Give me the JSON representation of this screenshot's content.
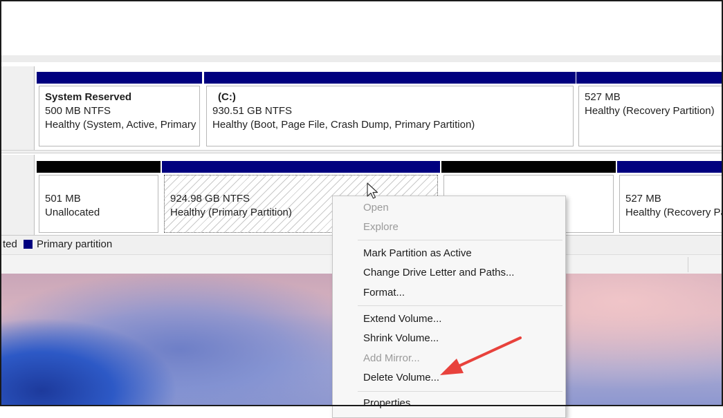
{
  "disks": {
    "disk0": {
      "partitions": [
        {
          "title": "System Reserved",
          "size": "500 MB NTFS",
          "status": "Healthy (System, Active, Primary"
        },
        {
          "title": "(C:)",
          "size": "930.51 GB NTFS",
          "status": "Healthy (Boot, Page File, Crash Dump, Primary Partition)"
        },
        {
          "title": "",
          "size": "527 MB",
          "status": "Healthy (Recovery Partition)"
        }
      ]
    },
    "disk1": {
      "partitions": [
        {
          "size": "501 MB",
          "status": "Unallocated"
        },
        {
          "size": "924.98 GB NTFS",
          "status": "Healthy (Primary Partition)"
        },
        {
          "size": "",
          "status": ""
        },
        {
          "size": "527 MB",
          "status": "Healthy (Recovery Pa"
        }
      ]
    }
  },
  "legend": {
    "partial_label": "ted",
    "primary_label": "Primary partition",
    "primary_color": "#00007f"
  },
  "context_menu": {
    "items": [
      {
        "label": "Open",
        "enabled": false
      },
      {
        "label": "Explore",
        "enabled": false
      },
      {
        "label": "Mark Partition as Active",
        "enabled": true
      },
      {
        "label": "Change Drive Letter and Paths...",
        "enabled": true
      },
      {
        "label": "Format...",
        "enabled": true
      },
      {
        "label": "Extend Volume...",
        "enabled": true
      },
      {
        "label": "Shrink Volume...",
        "enabled": true
      },
      {
        "label": "Add Mirror...",
        "enabled": false
      },
      {
        "label": "Delete Volume...",
        "enabled": true
      },
      {
        "label": "Properties",
        "enabled": true
      }
    ]
  },
  "annotation": {
    "arrow_color": "#e8423c",
    "target": "Delete Volume..."
  },
  "icons": {
    "cursor": "mouse-pointer-icon",
    "arrow": "annotation-arrow-icon"
  }
}
